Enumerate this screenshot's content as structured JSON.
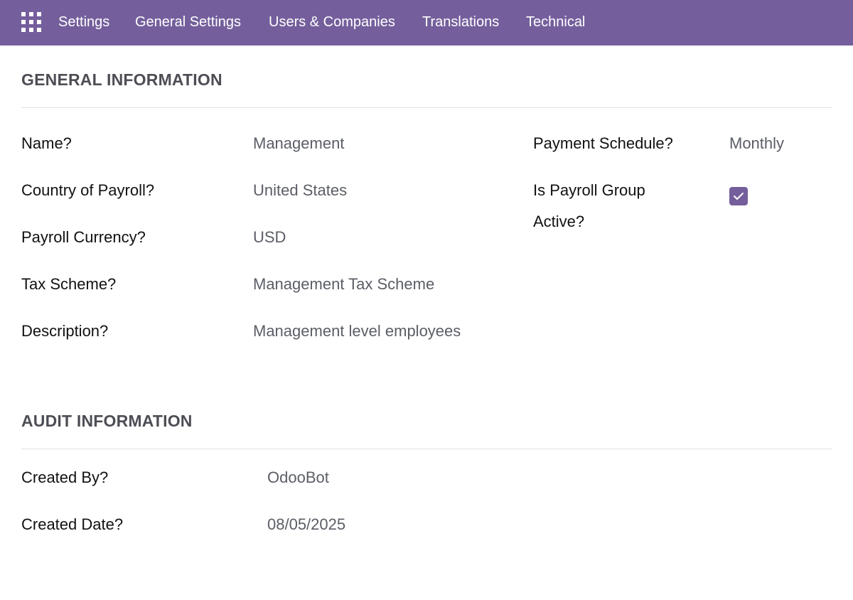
{
  "navbar": {
    "apps_icon": "apps-grid-icon",
    "items": [
      "Settings",
      "General Settings",
      "Users & Companies",
      "Translations",
      "Technical"
    ]
  },
  "general": {
    "title": "GENERAL INFORMATION",
    "fields": {
      "name_label": "Name?",
      "name_value": "Management",
      "country_label": "Country of Payroll?",
      "country_value": "United States",
      "currency_label": "Payroll Currency?",
      "currency_value": "USD",
      "tax_label": "Tax Scheme?",
      "tax_value": "Management Tax Scheme",
      "description_label": "Description?",
      "description_value": "Management level employees",
      "schedule_label": "Payment Schedule?",
      "schedule_value": "Monthly",
      "active_label_line1": "Is Payroll Group",
      "active_label_line2": "Active?",
      "active_checked": true
    }
  },
  "audit": {
    "title": "AUDIT INFORMATION",
    "created_by_label": "Created By?",
    "created_by_value": "OdooBot",
    "created_date_label": "Created Date?",
    "created_date_value": "08/05/2025"
  },
  "colors": {
    "brand": "#745f9c",
    "section_title": "#4d4e55",
    "value_text": "#5b5e66"
  }
}
